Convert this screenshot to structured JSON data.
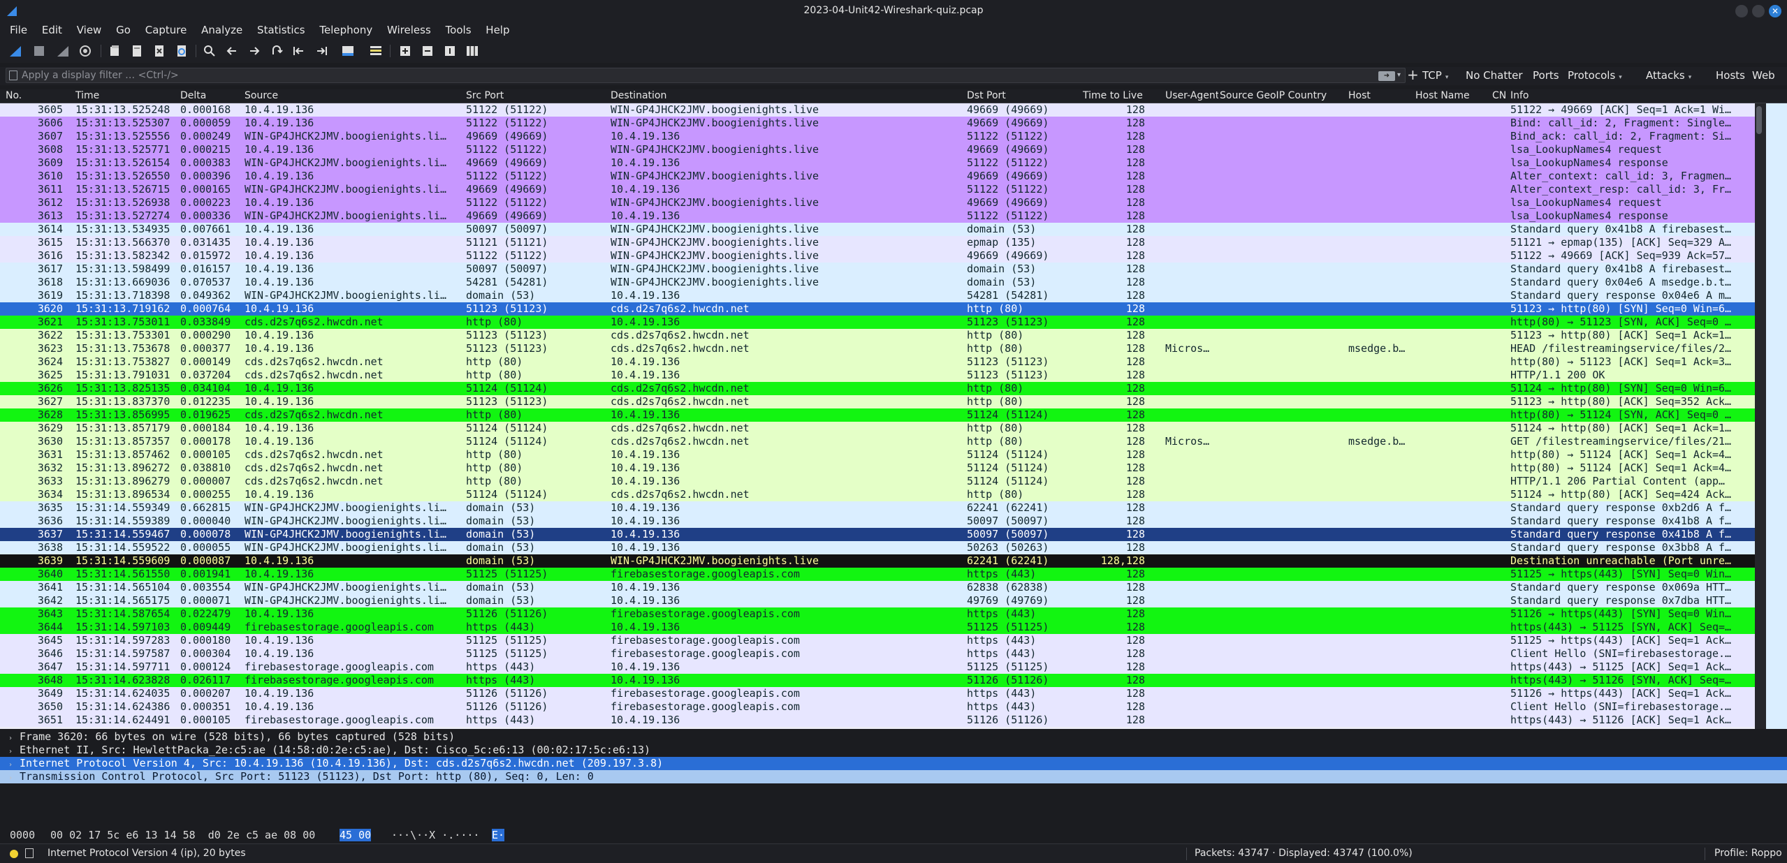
{
  "window": {
    "title": "2023-04-Unit42-Wireshark-quiz.pcap"
  },
  "menu": [
    "File",
    "Edit",
    "View",
    "Go",
    "Capture",
    "Analyze",
    "Statistics",
    "Telephony",
    "Wireless",
    "Tools",
    "Help"
  ],
  "filter": {
    "placeholder": "Apply a display filter … <Ctrl-/>",
    "buttons": [
      "TCP",
      "No Chatter",
      "Ports",
      "Protocols",
      "Attacks",
      "Hosts",
      "Web"
    ]
  },
  "columns": {
    "no": "No.",
    "time": "Time",
    "delta": "Delta",
    "source": "Source",
    "src_port": "Src Port",
    "destination": "Destination",
    "dst_port": "Dst Port",
    "ttl": "Time to Live",
    "ua": "User-Agent",
    "geo": "Source GeoIP Country",
    "host": "Host",
    "host_name": "Host Name",
    "cn": "CN",
    "info": "Info"
  },
  "packets": [
    {
      "no": "3605",
      "time": "15:31:13.525248",
      "delta": "0.000168",
      "src": "10.4.19.136",
      "sport": "51122 (51122)",
      "dst": "WIN-GP4JHCK2JMV.boogienights.live",
      "dport": "49669 (49669)",
      "ttl": "128",
      "ua": "",
      "host": "",
      "info": "51122 → 49669 [ACK] Seq=1 Ack=1 Wi…",
      "cls": "bg-tcp"
    },
    {
      "no": "3606",
      "time": "15:31:13.525307",
      "delta": "0.000059",
      "src": "10.4.19.136",
      "sport": "51122 (51122)",
      "dst": "WIN-GP4JHCK2JMV.boogienights.live",
      "dport": "49669 (49669)",
      "ttl": "128",
      "ua": "",
      "host": "",
      "info": "Bind: call_id: 2, Fragment: Single…",
      "cls": "bg-dce"
    },
    {
      "no": "3607",
      "time": "15:31:13.525556",
      "delta": "0.000249",
      "src": "WIN-GP4JHCK2JMV.boogienights.li…",
      "sport": "49669 (49669)",
      "dst": "10.4.19.136",
      "dport": "51122 (51122)",
      "ttl": "128",
      "ua": "",
      "host": "",
      "info": "Bind_ack: call_id: 2, Fragment: Si…",
      "cls": "bg-dce"
    },
    {
      "no": "3608",
      "time": "15:31:13.525771",
      "delta": "0.000215",
      "src": "10.4.19.136",
      "sport": "51122 (51122)",
      "dst": "WIN-GP4JHCK2JMV.boogienights.live",
      "dport": "49669 (49669)",
      "ttl": "128",
      "ua": "",
      "host": "",
      "info": "lsa_LookupNames4 request",
      "cls": "bg-dce"
    },
    {
      "no": "3609",
      "time": "15:31:13.526154",
      "delta": "0.000383",
      "src": "WIN-GP4JHCK2JMV.boogienights.li…",
      "sport": "49669 (49669)",
      "dst": "10.4.19.136",
      "dport": "51122 (51122)",
      "ttl": "128",
      "ua": "",
      "host": "",
      "info": "lsa_LookupNames4 response",
      "cls": "bg-dce"
    },
    {
      "no": "3610",
      "time": "15:31:13.526550",
      "delta": "0.000396",
      "src": "10.4.19.136",
      "sport": "51122 (51122)",
      "dst": "WIN-GP4JHCK2JMV.boogienights.live",
      "dport": "49669 (49669)",
      "ttl": "128",
      "ua": "",
      "host": "",
      "info": "Alter_context: call_id: 3, Fragmen…",
      "cls": "bg-dce"
    },
    {
      "no": "3611",
      "time": "15:31:13.526715",
      "delta": "0.000165",
      "src": "WIN-GP4JHCK2JMV.boogienights.li…",
      "sport": "49669 (49669)",
      "dst": "10.4.19.136",
      "dport": "51122 (51122)",
      "ttl": "128",
      "ua": "",
      "host": "",
      "info": "Alter_context_resp: call_id: 3, Fr…",
      "cls": "bg-dce"
    },
    {
      "no": "3612",
      "time": "15:31:13.526938",
      "delta": "0.000223",
      "src": "10.4.19.136",
      "sport": "51122 (51122)",
      "dst": "WIN-GP4JHCK2JMV.boogienights.live",
      "dport": "49669 (49669)",
      "ttl": "128",
      "ua": "",
      "host": "",
      "info": "lsa_LookupNames4 request",
      "cls": "bg-dce"
    },
    {
      "no": "3613",
      "time": "15:31:13.527274",
      "delta": "0.000336",
      "src": "WIN-GP4JHCK2JMV.boogienights.li…",
      "sport": "49669 (49669)",
      "dst": "10.4.19.136",
      "dport": "51122 (51122)",
      "ttl": "128",
      "ua": "",
      "host": "",
      "info": "lsa_LookupNames4 response",
      "cls": "bg-dce"
    },
    {
      "no": "3614",
      "time": "15:31:13.534935",
      "delta": "0.007661",
      "src": "10.4.19.136",
      "sport": "50097 (50097)",
      "dst": "WIN-GP4JHCK2JMV.boogienights.live",
      "dport": "domain (53)",
      "ttl": "128",
      "ua": "",
      "host": "",
      "info": "Standard query 0x41b8 A firebasest…",
      "cls": "bg-udp"
    },
    {
      "no": "3615",
      "time": "15:31:13.566370",
      "delta": "0.031435",
      "src": "10.4.19.136",
      "sport": "51121 (51121)",
      "dst": "WIN-GP4JHCK2JMV.boogienights.live",
      "dport": "epmap (135)",
      "ttl": "128",
      "ua": "",
      "host": "",
      "info": "51121 → epmap(135) [ACK] Seq=329 A…",
      "cls": "bg-tcp"
    },
    {
      "no": "3616",
      "time": "15:31:13.582342",
      "delta": "0.015972",
      "src": "10.4.19.136",
      "sport": "51122 (51122)",
      "dst": "WIN-GP4JHCK2JMV.boogienights.live",
      "dport": "49669 (49669)",
      "ttl": "128",
      "ua": "",
      "host": "",
      "info": "51122 → 49669 [ACK] Seq=939 Ack=57…",
      "cls": "bg-tcp"
    },
    {
      "no": "3617",
      "time": "15:31:13.598499",
      "delta": "0.016157",
      "src": "10.4.19.136",
      "sport": "50097 (50097)",
      "dst": "WIN-GP4JHCK2JMV.boogienights.live",
      "dport": "domain (53)",
      "ttl": "128",
      "ua": "",
      "host": "",
      "info": "Standard query 0x41b8 A firebasest…",
      "cls": "bg-udp"
    },
    {
      "no": "3618",
      "time": "15:31:13.669036",
      "delta": "0.070537",
      "src": "10.4.19.136",
      "sport": "54281 (54281)",
      "dst": "WIN-GP4JHCK2JMV.boogienights.live",
      "dport": "domain (53)",
      "ttl": "128",
      "ua": "",
      "host": "",
      "info": "Standard query 0x04e6 A msedge.b.t…",
      "cls": "bg-udp"
    },
    {
      "no": "3619",
      "time": "15:31:13.718398",
      "delta": "0.049362",
      "src": "WIN-GP4JHCK2JMV.boogienights.li…",
      "sport": "domain (53)",
      "dst": "10.4.19.136",
      "dport": "54281 (54281)",
      "ttl": "128",
      "ua": "",
      "host": "",
      "info": "Standard query response 0x04e6 A m…",
      "cls": "bg-udp"
    },
    {
      "no": "3620",
      "time": "15:31:13.719162",
      "delta": "0.000764",
      "src": "10.4.19.136",
      "sport": "51123 (51123)",
      "dst": "cds.d2s7q6s2.hwcdn.net",
      "dport": "http (80)",
      "ttl": "128",
      "ua": "",
      "host": "",
      "info": "51123 → http(80) [SYN] Seq=0 Win=6…",
      "cls": "bg-sel"
    },
    {
      "no": "3621",
      "time": "15:31:13.753011",
      "delta": "0.033849",
      "src": "cds.d2s7q6s2.hwcdn.net",
      "sport": "http (80)",
      "dst": "10.4.19.136",
      "dport": "51123 (51123)",
      "ttl": "128",
      "ua": "",
      "host": "",
      "info": "http(80) → 51123 [SYN, ACK] Seq=0 …",
      "cls": "bg-syn"
    },
    {
      "no": "3622",
      "time": "15:31:13.753301",
      "delta": "0.000290",
      "src": "10.4.19.136",
      "sport": "51123 (51123)",
      "dst": "cds.d2s7q6s2.hwcdn.net",
      "dport": "http (80)",
      "ttl": "128",
      "ua": "",
      "host": "",
      "info": "51123 → http(80) [ACK] Seq=1 Ack=1…",
      "cls": "bg-http"
    },
    {
      "no": "3623",
      "time": "15:31:13.753678",
      "delta": "0.000377",
      "src": "10.4.19.136",
      "sport": "51123 (51123)",
      "dst": "cds.d2s7q6s2.hwcdn.net",
      "dport": "http (80)",
      "ttl": "128",
      "ua": "Micros…",
      "host": "msedge.b…",
      "info": "HEAD /filestreamingservice/files/2…",
      "cls": "bg-http"
    },
    {
      "no": "3624",
      "time": "15:31:13.753827",
      "delta": "0.000149",
      "src": "cds.d2s7q6s2.hwcdn.net",
      "sport": "http (80)",
      "dst": "10.4.19.136",
      "dport": "51123 (51123)",
      "ttl": "128",
      "ua": "",
      "host": "",
      "info": "http(80) → 51123 [ACK] Seq=1 Ack=3…",
      "cls": "bg-http"
    },
    {
      "no": "3625",
      "time": "15:31:13.791031",
      "delta": "0.037204",
      "src": "cds.d2s7q6s2.hwcdn.net",
      "sport": "http (80)",
      "dst": "10.4.19.136",
      "dport": "51123 (51123)",
      "ttl": "128",
      "ua": "",
      "host": "",
      "info": "HTTP/1.1 200 OK",
      "cls": "bg-http"
    },
    {
      "no": "3626",
      "time": "15:31:13.825135",
      "delta": "0.034104",
      "src": "10.4.19.136",
      "sport": "51124 (51124)",
      "dst": "cds.d2s7q6s2.hwcdn.net",
      "dport": "http (80)",
      "ttl": "128",
      "ua": "",
      "host": "",
      "info": "51124 → http(80) [SYN] Seq=0 Win=6…",
      "cls": "bg-syn"
    },
    {
      "no": "3627",
      "time": "15:31:13.837370",
      "delta": "0.012235",
      "src": "10.4.19.136",
      "sport": "51123 (51123)",
      "dst": "cds.d2s7q6s2.hwcdn.net",
      "dport": "http (80)",
      "ttl": "128",
      "ua": "",
      "host": "",
      "info": "51123 → http(80) [ACK] Seq=352 Ack…",
      "cls": "bg-http"
    },
    {
      "no": "3628",
      "time": "15:31:13.856995",
      "delta": "0.019625",
      "src": "cds.d2s7q6s2.hwcdn.net",
      "sport": "http (80)",
      "dst": "10.4.19.136",
      "dport": "51124 (51124)",
      "ttl": "128",
      "ua": "",
      "host": "",
      "info": "http(80) → 51124 [SYN, ACK] Seq=0 …",
      "cls": "bg-syn"
    },
    {
      "no": "3629",
      "time": "15:31:13.857179",
      "delta": "0.000184",
      "src": "10.4.19.136",
      "sport": "51124 (51124)",
      "dst": "cds.d2s7q6s2.hwcdn.net",
      "dport": "http (80)",
      "ttl": "128",
      "ua": "",
      "host": "",
      "info": "51124 → http(80) [ACK] Seq=1 Ack=1…",
      "cls": "bg-http"
    },
    {
      "no": "3630",
      "time": "15:31:13.857357",
      "delta": "0.000178",
      "src": "10.4.19.136",
      "sport": "51124 (51124)",
      "dst": "cds.d2s7q6s2.hwcdn.net",
      "dport": "http (80)",
      "ttl": "128",
      "ua": "Micros…",
      "host": "msedge.b…",
      "info": "GET /filestreamingservice/files/21…",
      "cls": "bg-http"
    },
    {
      "no": "3631",
      "time": "15:31:13.857462",
      "delta": "0.000105",
      "src": "cds.d2s7q6s2.hwcdn.net",
      "sport": "http (80)",
      "dst": "10.4.19.136",
      "dport": "51124 (51124)",
      "ttl": "128",
      "ua": "",
      "host": "",
      "info": "http(80) → 51124 [ACK] Seq=1 Ack=4…",
      "cls": "bg-http"
    },
    {
      "no": "3632",
      "time": "15:31:13.896272",
      "delta": "0.038810",
      "src": "cds.d2s7q6s2.hwcdn.net",
      "sport": "http (80)",
      "dst": "10.4.19.136",
      "dport": "51124 (51124)",
      "ttl": "128",
      "ua": "",
      "host": "",
      "info": "http(80) → 51124 [ACK] Seq=1 Ack=4…",
      "cls": "bg-http"
    },
    {
      "no": "3633",
      "time": "15:31:13.896279",
      "delta": "0.000007",
      "src": "cds.d2s7q6s2.hwcdn.net",
      "sport": "http (80)",
      "dst": "10.4.19.136",
      "dport": "51124 (51124)",
      "ttl": "128",
      "ua": "",
      "host": "",
      "info": "HTTP/1.1 206 Partial Content  (app…",
      "cls": "bg-http"
    },
    {
      "no": "3634",
      "time": "15:31:13.896534",
      "delta": "0.000255",
      "src": "10.4.19.136",
      "sport": "51124 (51124)",
      "dst": "cds.d2s7q6s2.hwcdn.net",
      "dport": "http (80)",
      "ttl": "128",
      "ua": "",
      "host": "",
      "info": "51124 → http(80) [ACK] Seq=424 Ack…",
      "cls": "bg-http"
    },
    {
      "no": "3635",
      "time": "15:31:14.559349",
      "delta": "0.662815",
      "src": "WIN-GP4JHCK2JMV.boogienights.li…",
      "sport": "domain (53)",
      "dst": "10.4.19.136",
      "dport": "62241 (62241)",
      "ttl": "128",
      "ua": "",
      "host": "",
      "info": "Standard query response 0xb2d6 A f…",
      "cls": "bg-udp"
    },
    {
      "no": "3636",
      "time": "15:31:14.559389",
      "delta": "0.000040",
      "src": "WIN-GP4JHCK2JMV.boogienights.li…",
      "sport": "domain (53)",
      "dst": "10.4.19.136",
      "dport": "50097 (50097)",
      "ttl": "128",
      "ua": "",
      "host": "",
      "info": "Standard query response 0x41b8 A f…",
      "cls": "bg-udp"
    },
    {
      "no": "3637",
      "time": "15:31:14.559467",
      "delta": "0.000078",
      "src": "WIN-GP4JHCK2JMV.boogienights.li…",
      "sport": "domain (53)",
      "dst": "10.4.19.136",
      "dport": "50097 (50097)",
      "ttl": "128",
      "ua": "",
      "host": "",
      "info": "Standard query response 0x41b8 A f…",
      "cls": "bg-sel2"
    },
    {
      "no": "3638",
      "time": "15:31:14.559522",
      "delta": "0.000055",
      "src": "WIN-GP4JHCK2JMV.boogienights.li…",
      "sport": "domain (53)",
      "dst": "10.4.19.136",
      "dport": "50263 (50263)",
      "ttl": "128",
      "ua": "",
      "host": "",
      "info": "Standard query response 0x3bb8 A f…",
      "cls": "bg-udp"
    },
    {
      "no": "3639",
      "time": "15:31:14.559609",
      "delta": "0.000087",
      "src": "10.4.19.136",
      "sport": "domain (53)",
      "dst": "WIN-GP4JHCK2JMV.boogienights.live",
      "dport": "62241 (62241)",
      "ttl": "128,128",
      "ua": "",
      "host": "",
      "info": "Destination unreachable (Port unre…",
      "cls": "bg-err"
    },
    {
      "no": "3640",
      "time": "15:31:14.561550",
      "delta": "0.001941",
      "src": "10.4.19.136",
      "sport": "51125 (51125)",
      "dst": "firebasestorage.googleapis.com",
      "dport": "https (443)",
      "ttl": "128",
      "ua": "",
      "host": "",
      "info": "51125 → https(443) [SYN] Seq=0 Win…",
      "cls": "bg-syn"
    },
    {
      "no": "3641",
      "time": "15:31:14.565104",
      "delta": "0.003554",
      "src": "WIN-GP4JHCK2JMV.boogienights.li…",
      "sport": "domain (53)",
      "dst": "10.4.19.136",
      "dport": "62838 (62838)",
      "ttl": "128",
      "ua": "",
      "host": "",
      "info": "Standard query response 0x069a HTT…",
      "cls": "bg-udp"
    },
    {
      "no": "3642",
      "time": "15:31:14.565175",
      "delta": "0.000071",
      "src": "WIN-GP4JHCK2JMV.boogienights.li…",
      "sport": "domain (53)",
      "dst": "10.4.19.136",
      "dport": "49769 (49769)",
      "ttl": "128",
      "ua": "",
      "host": "",
      "info": "Standard query response 0x7dba HTT…",
      "cls": "bg-udp"
    },
    {
      "no": "3643",
      "time": "15:31:14.587654",
      "delta": "0.022479",
      "src": "10.4.19.136",
      "sport": "51126 (51126)",
      "dst": "firebasestorage.googleapis.com",
      "dport": "https (443)",
      "ttl": "128",
      "ua": "",
      "host": "",
      "info": "51126 → https(443) [SYN] Seq=0 Win…",
      "cls": "bg-syn"
    },
    {
      "no": "3644",
      "time": "15:31:14.597103",
      "delta": "0.009449",
      "src": "firebasestorage.googleapis.com",
      "sport": "https (443)",
      "dst": "10.4.19.136",
      "dport": "51125 (51125)",
      "ttl": "128",
      "ua": "",
      "host": "",
      "info": "https(443) → 51125 [SYN, ACK] Seq=…",
      "cls": "bg-syn"
    },
    {
      "no": "3645",
      "time": "15:31:14.597283",
      "delta": "0.000180",
      "src": "10.4.19.136",
      "sport": "51125 (51125)",
      "dst": "firebasestorage.googleapis.com",
      "dport": "https (443)",
      "ttl": "128",
      "ua": "",
      "host": "",
      "info": "51125 → https(443) [ACK] Seq=1 Ack…",
      "cls": "bg-tcp"
    },
    {
      "no": "3646",
      "time": "15:31:14.597587",
      "delta": "0.000304",
      "src": "10.4.19.136",
      "sport": "51125 (51125)",
      "dst": "firebasestorage.googleapis.com",
      "dport": "https (443)",
      "ttl": "128",
      "ua": "",
      "host": "",
      "info": "Client Hello (SNI=firebasestorage.…",
      "cls": "bg-tcp"
    },
    {
      "no": "3647",
      "time": "15:31:14.597711",
      "delta": "0.000124",
      "src": "firebasestorage.googleapis.com",
      "sport": "https (443)",
      "dst": "10.4.19.136",
      "dport": "51125 (51125)",
      "ttl": "128",
      "ua": "",
      "host": "",
      "info": "https(443) → 51125 [ACK] Seq=1 Ack…",
      "cls": "bg-tcp"
    },
    {
      "no": "3648",
      "time": "15:31:14.623828",
      "delta": "0.026117",
      "src": "firebasestorage.googleapis.com",
      "sport": "https (443)",
      "dst": "10.4.19.136",
      "dport": "51126 (51126)",
      "ttl": "128",
      "ua": "",
      "host": "",
      "info": "https(443) → 51126 [SYN, ACK] Seq=…",
      "cls": "bg-syn"
    },
    {
      "no": "3649",
      "time": "15:31:14.624035",
      "delta": "0.000207",
      "src": "10.4.19.136",
      "sport": "51126 (51126)",
      "dst": "firebasestorage.googleapis.com",
      "dport": "https (443)",
      "ttl": "128",
      "ua": "",
      "host": "",
      "info": "51126 → https(443) [ACK] Seq=1 Ack…",
      "cls": "bg-tcp"
    },
    {
      "no": "3650",
      "time": "15:31:14.624386",
      "delta": "0.000351",
      "src": "10.4.19.136",
      "sport": "51126 (51126)",
      "dst": "firebasestorage.googleapis.com",
      "dport": "https (443)",
      "ttl": "128",
      "ua": "",
      "host": "",
      "info": "Client Hello (SNI=firebasestorage.…",
      "cls": "bg-tcp"
    },
    {
      "no": "3651",
      "time": "15:31:14.624491",
      "delta": "0.000105",
      "src": "firebasestorage.googleapis.com",
      "sport": "https (443)",
      "dst": "10.4.19.136",
      "dport": "51126 (51126)",
      "ttl": "128",
      "ua": "",
      "host": "",
      "info": "https(443) → 51126 [ACK] Seq=1 Ack…",
      "cls": "bg-tcp"
    }
  ],
  "details": [
    {
      "text": "Frame 3620: 66 bytes on wire (528 bits), 66 bytes captured (528 bits)",
      "cls": ""
    },
    {
      "text": "Ethernet II, Src: HewlettPacka_2e:c5:ae (14:58:d0:2e:c5:ae), Dst: Cisco_5c:e6:13 (00:02:17:5c:e6:13)",
      "cls": ""
    },
    {
      "text": "Internet Protocol Version 4, Src: 10.4.19.136 (10.4.19.136), Dst: cds.d2s7q6s2.hwcdn.net (209.197.3.8)",
      "cls": "sel"
    },
    {
      "text": "Transmission Control Protocol, Src Port: 51123 (51123), Dst Port: http (80), Seq: 0, Len: 0",
      "cls": "sel2"
    }
  ],
  "bytes": {
    "offset": "0000",
    "hex": "00 02 17 5c e6 13 14 58  d0 2e c5 ae 08 00",
    "hex_hl": "45 00",
    "ascii": "···\\··X ·.····",
    "ascii_hl": "E·"
  },
  "status": {
    "left": "Internet Protocol Version 4 (ip), 20 bytes",
    "packets": "Packets: 43747 · Displayed: 43747 (100.0%)",
    "profile": "Profile: Roppo"
  }
}
